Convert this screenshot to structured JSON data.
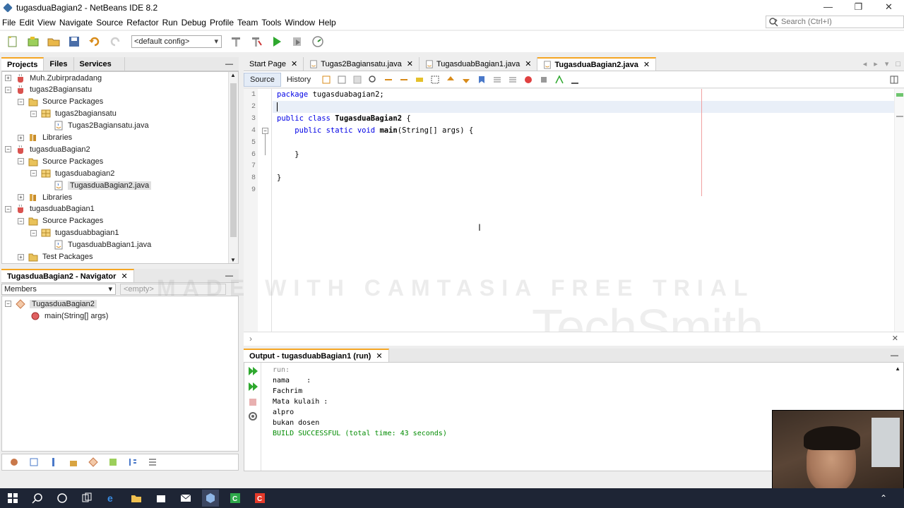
{
  "window": {
    "title": "tugasduaBagian2 - NetBeans IDE 8.2",
    "controls": [
      "—",
      "❐",
      "✕"
    ]
  },
  "menu": [
    "File",
    "Edit",
    "View",
    "Navigate",
    "Source",
    "Refactor",
    "Run",
    "Debug",
    "Profile",
    "Team",
    "Tools",
    "Window",
    "Help"
  ],
  "search": {
    "placeholder": "Search (Ctrl+I)"
  },
  "toolbar": {
    "config": "<default config>"
  },
  "left_tabs": {
    "projects": "Projects",
    "files": "Files",
    "services": "Services"
  },
  "tree": [
    {
      "label": "Muh.Zubirpradadang",
      "indent": 0,
      "exp": "+",
      "icon": "project-icon"
    },
    {
      "label": "tugas2Bagiansatu",
      "indent": 0,
      "exp": "−",
      "icon": "project-icon"
    },
    {
      "label": "Source Packages",
      "indent": 1,
      "exp": "−",
      "icon": "package-folder-icon"
    },
    {
      "label": "tugas2bagiansatu",
      "indent": 2,
      "exp": "−",
      "icon": "package-icon"
    },
    {
      "label": "Tugas2Bagiansatu.java",
      "indent": 3,
      "exp": "",
      "icon": "java-file-icon"
    },
    {
      "label": "Libraries",
      "indent": 1,
      "exp": "+",
      "icon": "library-icon"
    },
    {
      "label": "tugasduaBagian2",
      "indent": 0,
      "exp": "−",
      "icon": "project-icon"
    },
    {
      "label": "Source Packages",
      "indent": 1,
      "exp": "−",
      "icon": "package-folder-icon"
    },
    {
      "label": "tugasduabagian2",
      "indent": 2,
      "exp": "−",
      "icon": "package-icon"
    },
    {
      "label": "TugasduaBagian2.java",
      "indent": 3,
      "exp": "",
      "icon": "java-file-icon",
      "selected": true
    },
    {
      "label": "Libraries",
      "indent": 1,
      "exp": "+",
      "icon": "library-icon"
    },
    {
      "label": "tugasduabBagian1",
      "indent": 0,
      "exp": "−",
      "icon": "project-icon"
    },
    {
      "label": "Source Packages",
      "indent": 1,
      "exp": "−",
      "icon": "package-folder-icon"
    },
    {
      "label": "tugasduabbagian1",
      "indent": 2,
      "exp": "−",
      "icon": "package-icon"
    },
    {
      "label": "TugasduabBagian1.java",
      "indent": 3,
      "exp": "",
      "icon": "java-file-icon"
    },
    {
      "label": "Test Packages",
      "indent": 1,
      "exp": "+",
      "icon": "package-folder-icon"
    }
  ],
  "navigator": {
    "title": "TugasduaBagian2 - Navigator",
    "members": "Members",
    "filter": "<empty>",
    "class": "TugasduaBagian2",
    "method": "main(String[] args)"
  },
  "editor_tabs": [
    {
      "label": "Start Page",
      "active": false
    },
    {
      "label": "Tugas2Bagiansatu.java",
      "active": false
    },
    {
      "label": "TugasduabBagian1.java",
      "active": false
    },
    {
      "label": "TugasduaBagian2.java",
      "active": true
    }
  ],
  "editor_mode": {
    "source": "Source",
    "history": "History"
  },
  "code_lines": [
    {
      "n": "1",
      "text": "package tugasduabagian2;"
    },
    {
      "n": "2",
      "text": ""
    },
    {
      "n": "3",
      "text": "public class TugasduaBagian2 {"
    },
    {
      "n": "4",
      "text": "    public static void main(String[] args) {"
    },
    {
      "n": "5",
      "text": ""
    },
    {
      "n": "6",
      "text": "    }"
    },
    {
      "n": "7",
      "text": ""
    },
    {
      "n": "8",
      "text": "}"
    },
    {
      "n": "9",
      "text": ""
    }
  ],
  "output": {
    "title": "Output - tugasduabBagian1 (run)",
    "lines": [
      {
        "text": "run:",
        "style": "dim"
      },
      {
        "text": "nama    :",
        "style": ""
      },
      {
        "text": "Fachrim",
        "style": ""
      },
      {
        "text": "Mata kulaih :",
        "style": ""
      },
      {
        "text": "alpro",
        "style": ""
      },
      {
        "text": "bukan dosen",
        "style": ""
      },
      {
        "text": "BUILD SUCCESSFUL (total time: 43 seconds)",
        "style": "green"
      }
    ]
  },
  "watermark": {
    "brand": "TechSmith",
    "trial": "MADE WITH CAMTASIA FREE TRIAL"
  },
  "taskbar": [
    "windows-start-icon",
    "search-icon",
    "cortana-icon",
    "task-view-icon",
    "edge-icon",
    "file-explorer-icon",
    "store-icon",
    "mail-icon",
    "netbeans-icon",
    "app-green-icon",
    "camtasia-icon"
  ],
  "colors": {
    "accent_tab": "#f5a623",
    "keyword": "#0000e6",
    "build_success": "#008b00",
    "taskbar": "#1e2535"
  }
}
